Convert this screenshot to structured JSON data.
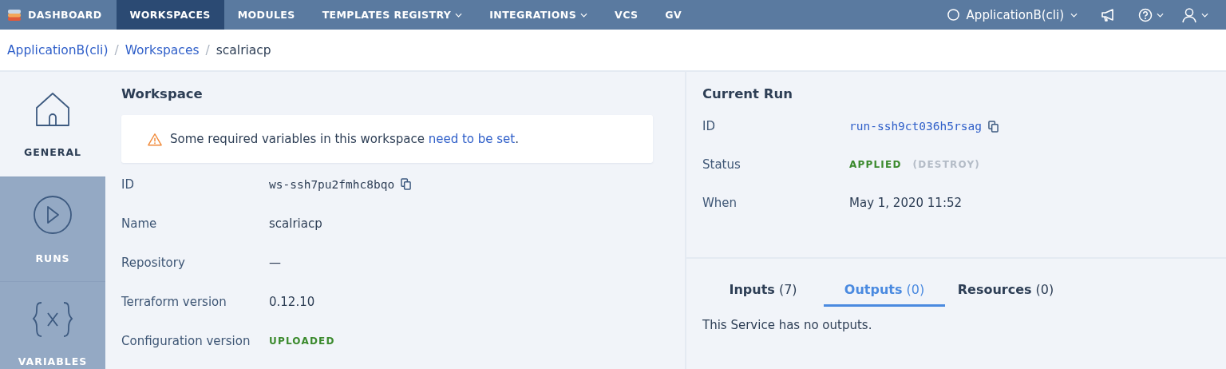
{
  "nav": {
    "brand": "DASHBOARD",
    "items": [
      {
        "label": "WORKSPACES",
        "selected": true,
        "dropdown": false
      },
      {
        "label": "MODULES",
        "selected": false,
        "dropdown": false
      },
      {
        "label": "TEMPLATES REGISTRY",
        "selected": false,
        "dropdown": true
      },
      {
        "label": "INTEGRATIONS",
        "selected": false,
        "dropdown": true
      },
      {
        "label": "VCS",
        "selected": false,
        "dropdown": false
      },
      {
        "label": "GV",
        "selected": false,
        "dropdown": false
      }
    ],
    "environment": "ApplicationB(cli)"
  },
  "breadcrumb": {
    "separator": "/",
    "items": [
      {
        "label": "ApplicationB(cli)",
        "kind": "link"
      },
      {
        "label": "Workspaces",
        "kind": "link"
      },
      {
        "label": "scalriacp",
        "kind": "current"
      }
    ]
  },
  "sidebar": {
    "items": [
      {
        "label": "GENERAL",
        "kind": "home",
        "selected": true
      },
      {
        "label": "RUNS",
        "kind": "play",
        "selected": false
      },
      {
        "label": "VARIABLES",
        "kind": "braces",
        "selected": false
      }
    ]
  },
  "workspace": {
    "title": "Workspace",
    "alert": {
      "text": "Some required variables in this workspace ",
      "link": "need to be set",
      "end": "."
    },
    "fields": [
      {
        "label": "ID",
        "value": "ws-ssh7pu2fmhc8bqo",
        "kind": "code"
      },
      {
        "label": "Name",
        "value": "scalriacp",
        "kind": "text"
      },
      {
        "label": "Repository",
        "value": "—",
        "kind": "text"
      },
      {
        "label": "Terraform version",
        "value": "0.12.10",
        "kind": "text"
      },
      {
        "label": "Configuration version",
        "value": "UPLOADED",
        "kind": "status"
      }
    ]
  },
  "current_run": {
    "title": "Current Run",
    "fields": [
      {
        "label": "ID",
        "kind": "link-code",
        "value": "run-ssh9ct036h5rsag"
      },
      {
        "label": "Status",
        "kind": "status",
        "value": "APPLIED",
        "note": "(DESTROY)"
      },
      {
        "label": "When",
        "kind": "text",
        "value": "May 1, 2020 11:52"
      }
    ],
    "tabs": [
      {
        "label": "Inputs",
        "count": "(7)",
        "selected": false
      },
      {
        "label": "Outputs",
        "count": "(0)",
        "selected": true
      },
      {
        "label": "Resources",
        "count": "(0)",
        "selected": false
      }
    ],
    "empty_message": "This Service has no outputs."
  }
}
